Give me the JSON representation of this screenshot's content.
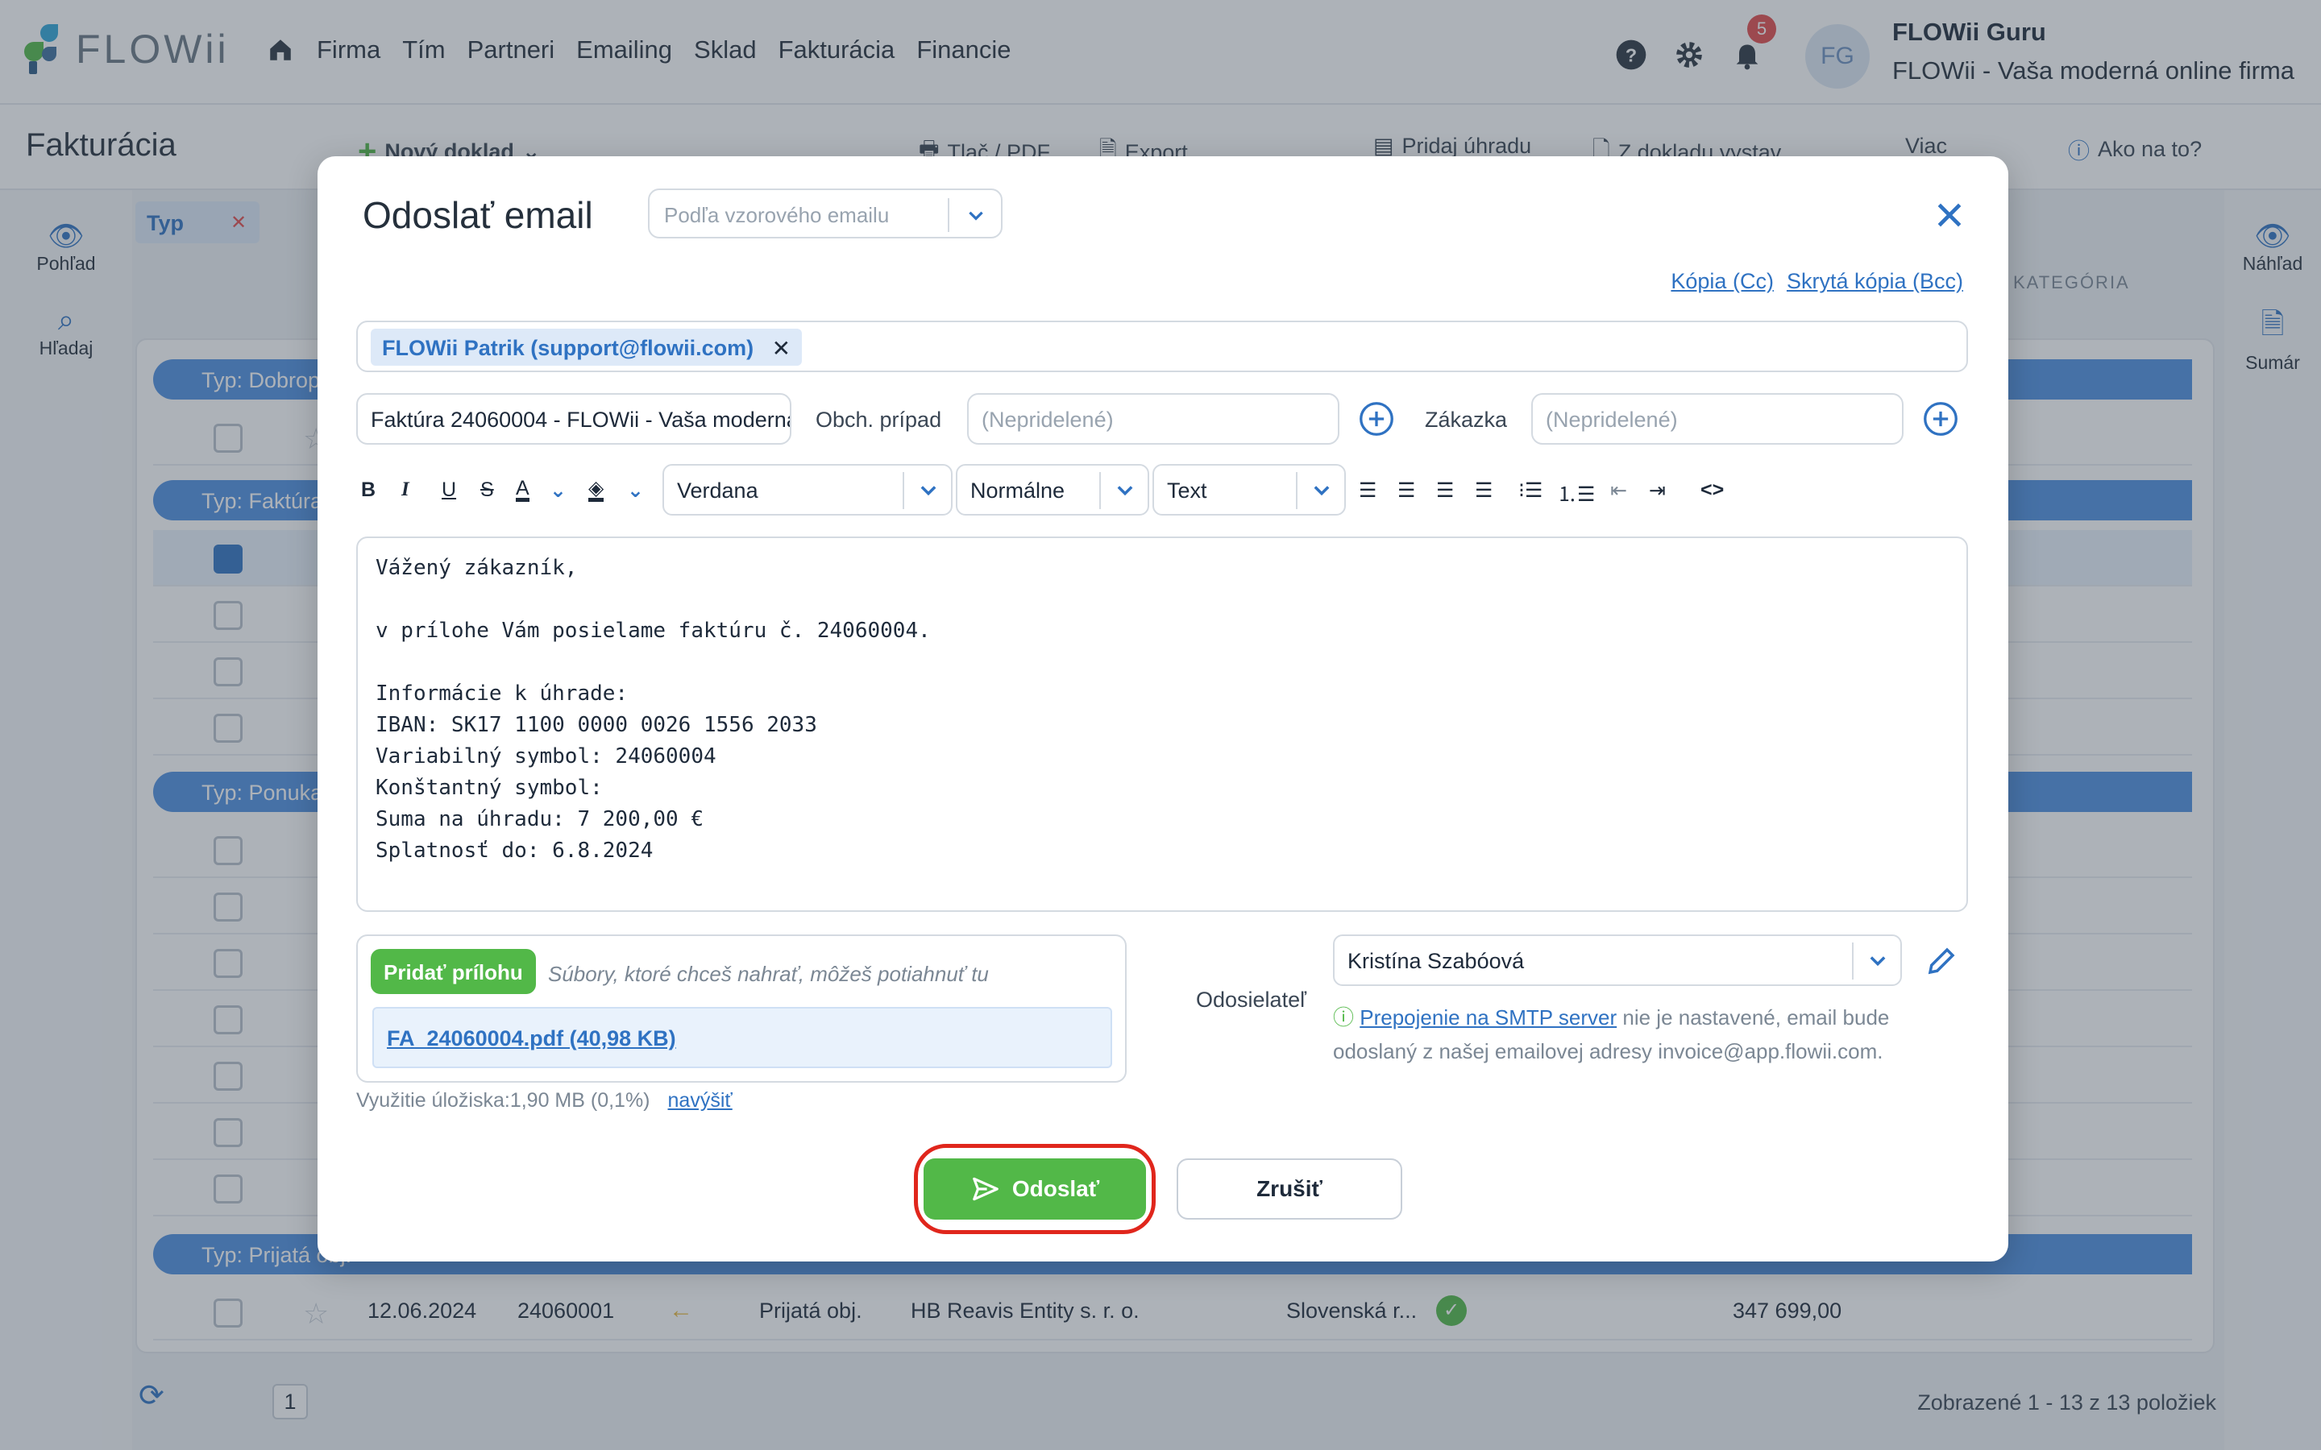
{
  "app": {
    "logo_text": "FLOWii"
  },
  "nav": {
    "items": [
      "Firma",
      "Tím",
      "Partneri",
      "Emailing",
      "Sklad",
      "Fakturácia",
      "Financie"
    ]
  },
  "header": {
    "notifications_count": "5",
    "avatar_initials": "FG",
    "user_name": "FLOWii Guru",
    "company": "FLOWii - Vaša moderná online firma"
  },
  "page": {
    "title": "Fakturácia"
  },
  "toolbar": {
    "new_doc": "Nový doklad",
    "print_pdf": "Tlač / PDF",
    "export": "Export",
    "add_payment": "Pridaj úhradu",
    "from_doc": "Z dokladu vystav",
    "more": "Viac",
    "help": "Ako na to?"
  },
  "leftnav": {
    "view": "Pohľad",
    "search": "Hľadaj"
  },
  "rightnav": {
    "preview": "Náhľad",
    "summary": "Sumár"
  },
  "filter": {
    "chip": "Typ",
    "category_header": "KATEGÓRIA"
  },
  "groups": [
    "Typ: Dobrop",
    "Typ: Faktúra",
    "Typ: Ponuka",
    "Typ: Prijatá obj."
  ],
  "last_row": {
    "date": "12.06.2024",
    "number": "24060001",
    "type": "Prijatá obj.",
    "partner": "HB Reavis Entity s. r. o.",
    "country": "Slovenská r...",
    "amount": "347 699,00"
  },
  "pagination": {
    "page": "1",
    "count": "Zobrazené 1 - 13 z 13 položiek"
  },
  "modal": {
    "title": "Odoslať email",
    "template_placeholder": "Podľa vzorového emailu",
    "cc": "Kópia (Cc)",
    "bcc": "Skrytá kópia (Bcc)",
    "recipient": "FLOWii Patrik (support@flowii.com)",
    "subject": "Faktúra 24060004 - FLOWii - Vaša moderná online firma",
    "case_label": "Obch. prípad",
    "case_placeholder": "(Nepridelené)",
    "order_label": "Zákazka",
    "order_placeholder": "(Nepridelené)",
    "font": "Verdana",
    "size": "Normálne",
    "format": "Text",
    "body": "Vážený zákazník,\n\nv prílohe Vám posielame faktúru č. 24060004.\n\nInformácie k úhrade:\nIBAN: SK17 1100 0000 0026 1556 2033\nVariabilný symbol: 24060004\nKonštantný symbol:\nSuma na úhradu: 7 200,00 €\nSplatnosť do: 6.8.2024",
    "add_attachment": "Pridať prílohu",
    "drop_hint": "Súbory, ktoré chceš nahrať, môžeš potiahnuť tu",
    "file": "FA_24060004.pdf (40,98 KB)",
    "storage_usage": "Využitie úložiska:1,90 MB (0,1%)",
    "storage_upgrade": "navýšiť",
    "sender_label": "Odosielateľ",
    "sender": "Kristína Szabóová",
    "smtp_link": "Prepojenie na SMTP server",
    "smtp_text": " nie je nastavené, email bude odoslaný z našej emailovej adresy invoice@app.flowii.com.",
    "send": "Odoslať",
    "cancel": "Zrušiť"
  }
}
